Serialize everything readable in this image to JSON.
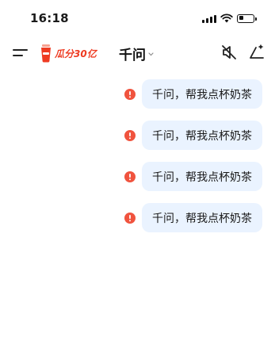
{
  "status_bar": {
    "time": "16:18",
    "signal_icon": "cellular-signal-icon",
    "wifi_icon": "wifi-icon",
    "battery_icon": "battery-icon",
    "battery_level": 0.35
  },
  "header": {
    "menu_icon": "menu-icon",
    "promo": {
      "icon": "milk-tea-cup-icon",
      "text": "瓜分30亿",
      "color": "#ee3b22"
    },
    "title": "千问",
    "title_caret_icon": "chevron-down-icon",
    "mute_icon": "speaker-muted-icon",
    "new_chat_icon": "new-chat-sparkle-icon"
  },
  "colors": {
    "bubble_bg": "#eaf3ff",
    "error": "#f0533e",
    "text": "#1a1a1a"
  },
  "messages": [
    {
      "text": "千问，帮我点杯奶茶",
      "status": "failed",
      "status_icon": "error-icon"
    },
    {
      "text": "千问，帮我点杯奶茶",
      "status": "failed",
      "status_icon": "error-icon"
    },
    {
      "text": "千问，帮我点杯奶茶",
      "status": "failed",
      "status_icon": "error-icon"
    },
    {
      "text": "千问，帮我点杯奶茶",
      "status": "failed",
      "status_icon": "error-icon"
    }
  ]
}
